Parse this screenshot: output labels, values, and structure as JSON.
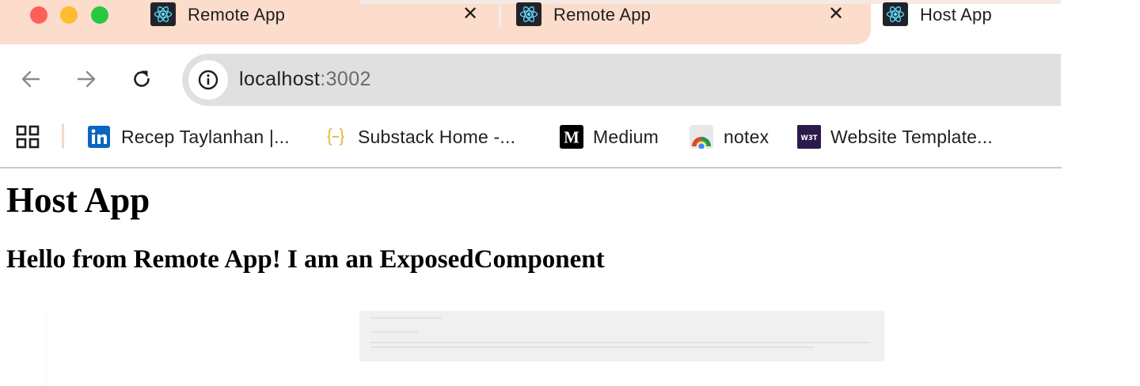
{
  "tabs": [
    {
      "title": "Remote App",
      "icon": "react-icon",
      "closable": true
    },
    {
      "title": "Remote App",
      "icon": "react-icon",
      "closable": true
    },
    {
      "title": "Host App",
      "icon": "react-icon",
      "closable": false
    }
  ],
  "tab_close_glyph": "✕",
  "address_bar": {
    "host": "localhost",
    "port": ":3002"
  },
  "bookmarks": [
    {
      "label": "Recep Taylanhan |...",
      "icon": "linkedin-icon"
    },
    {
      "label": "Substack Home -...",
      "icon": "braces-icon"
    },
    {
      "label": "Medium",
      "icon": "medium-icon"
    },
    {
      "label": "notex",
      "icon": "chrome-icon"
    },
    {
      "label": "Website Template...",
      "icon": "w3t-icon"
    }
  ],
  "bookmark_icon_text": {
    "medium": "M",
    "w3t": "W3T"
  },
  "page": {
    "heading": "Host App",
    "subheading": "Hello from Remote App! I am an ExposedComponent"
  },
  "colors": {
    "tabstrip": "#fcdccb",
    "omnibox": "#e0e0e0",
    "traffic_red": "#fe5f57",
    "traffic_yellow": "#febc2e",
    "traffic_green": "#28c840",
    "linkedin": "#0a66c2",
    "react": "#61dafb"
  }
}
